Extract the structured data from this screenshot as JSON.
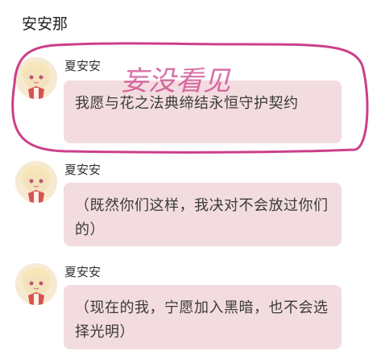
{
  "chat": {
    "title": "安安那"
  },
  "messages": [
    {
      "sender": "夏安安",
      "text": "我愿与花之法典缔结永恒守护契约"
    },
    {
      "sender": "夏安安",
      "text": "（既然你们这样，我决对不会放过你们的）"
    },
    {
      "sender": "夏安安",
      "text": "（现在的我，宁愿加入黑暗，也不会选择光明）"
    }
  ],
  "annotation": {
    "text": "妄没看见",
    "color": "#cc3f8a"
  },
  "colors": {
    "bubble": "#f3dcdf",
    "text": "#3a3a3a"
  }
}
